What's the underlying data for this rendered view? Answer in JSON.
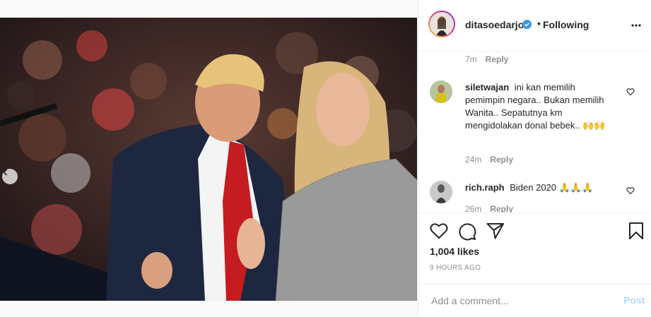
{
  "post": {
    "username": "ditasoedarjo",
    "follow_status": "Following",
    "separator": "•",
    "icons": {
      "verified": "verified-badge-icon",
      "more": "more-options-icon"
    },
    "carousel": {
      "total": 2,
      "active_index": 1
    }
  },
  "comments": [
    {
      "time": "7m",
      "reply_label": "Reply"
    },
    {
      "username": "siletwajan",
      "text": "ini kan memilih pemimpin negara.. Bukan memilih Wanita.. Sepatutnya km mengidolakan donal bebek.. 🙌🙌",
      "time": "24m",
      "reply_label": "Reply"
    },
    {
      "username": "rich.raph",
      "text": "Biden 2020 🙏🙏🙏",
      "time": "26m",
      "reply_label": "Reply"
    }
  ],
  "actions": {
    "icons": [
      "heart-icon",
      "comment-icon",
      "share-icon",
      "bookmark-icon"
    ]
  },
  "likes_text": "1,004 likes",
  "time_ago": "9 HOURS AGO",
  "add_comment": {
    "placeholder": "Add a comment...",
    "post_label": "Post"
  },
  "colors": {
    "verified_blue": "#3897f0",
    "post_disabled": "#b3dbff",
    "muted": "#8e8e8e"
  }
}
